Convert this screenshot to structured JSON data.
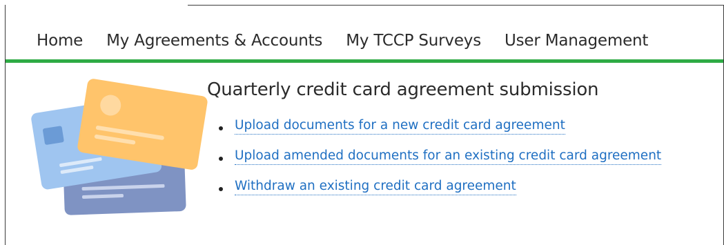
{
  "nav": {
    "items": [
      {
        "label": "Home"
      },
      {
        "label": "My Agreements & Accounts"
      },
      {
        "label": "My TCCP Surveys"
      },
      {
        "label": "User Management"
      }
    ]
  },
  "main": {
    "title": "Quarterly credit card agreement submission",
    "links": [
      {
        "label": "Upload documents for a new credit card agreement"
      },
      {
        "label": "Upload amended documents for an existing credit card agreement"
      },
      {
        "label": "Withdraw an existing credit card agreement"
      }
    ]
  },
  "colors": {
    "nav_rule": "#2eab44",
    "link": "#1f6fc2",
    "card_front": "#ffc46b",
    "card_middle": "#9dc4ef",
    "card_back": "#7e93c2"
  },
  "icons": {
    "illustration": "credit-cards-illustration"
  }
}
